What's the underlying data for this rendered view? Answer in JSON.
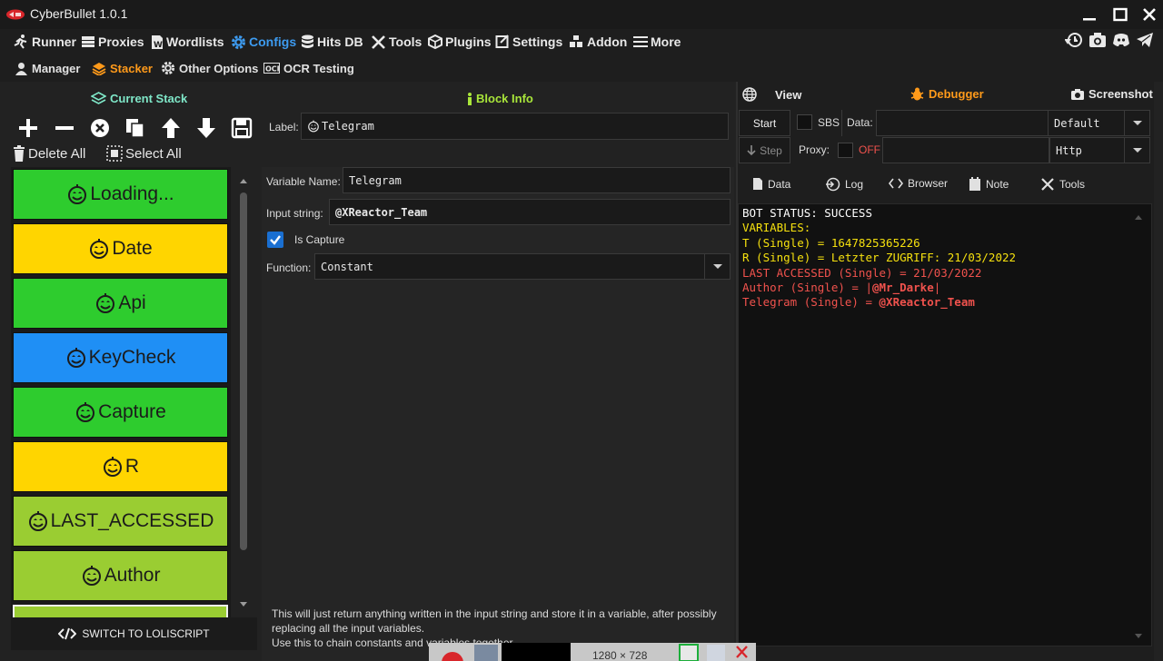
{
  "app": {
    "title": "CyberBullet 1.0.1"
  },
  "main_menu": [
    {
      "label": "Runner",
      "icon": "runner-icon"
    },
    {
      "label": "Proxies",
      "icon": "proxies-icon"
    },
    {
      "label": "Wordlists",
      "icon": "wordlists-icon"
    },
    {
      "label": "Configs",
      "icon": "gear-icon",
      "active": true
    },
    {
      "label": "Hits DB",
      "icon": "database-icon"
    },
    {
      "label": "Tools",
      "icon": "tools-icon"
    },
    {
      "label": "Plugins",
      "icon": "plugins-icon"
    },
    {
      "label": "Settings",
      "icon": "settings-icon"
    },
    {
      "label": "Addon",
      "icon": "addon-icon"
    },
    {
      "label": "More",
      "icon": "hamburger-icon"
    }
  ],
  "sub_menu": [
    {
      "label": "Manager",
      "icon": "user-icon"
    },
    {
      "label": "Stacker",
      "icon": "layers-icon",
      "active": true
    },
    {
      "label": "Other Options",
      "icon": "gear-icon"
    },
    {
      "label": "OCR Testing",
      "icon": "ocr-icon"
    }
  ],
  "left": {
    "title": "Current Stack",
    "delete_all": "Delete All",
    "select_all": "Select All",
    "switch_label": "SWITCH TO LOLISCRIPT"
  },
  "stack_blocks": [
    {
      "label": "Loading...",
      "color": "#2ecc2e"
    },
    {
      "label": "Date",
      "color": "#ffd500"
    },
    {
      "label": "Api",
      "color": "#2ecc2e"
    },
    {
      "label": "KeyCheck",
      "color": "#1f8ff5"
    },
    {
      "label": "Capture",
      "color": "#2ecc2e"
    },
    {
      "label": "R",
      "color": "#ffd500"
    },
    {
      "label": "LAST_ACCESSED",
      "color": "#9acd32"
    },
    {
      "label": "Author",
      "color": "#9acd32"
    }
  ],
  "block_info": {
    "title": "Block Info",
    "label_caption": "Label:",
    "label_value": "Telegram",
    "variable_name_caption": "Variable Name:",
    "variable_name_value": "Telegram",
    "input_string_caption": "Input string:",
    "input_string_value": "@XReactor_Team",
    "is_capture_label": "Is Capture",
    "function_caption": "Function:",
    "function_value": "Constant",
    "description_1": "This will just return anything written in the input string and store it in a variable, after possibly replacing all the input variables.",
    "description_2": "Use this to chain constants and variables together."
  },
  "debugger": {
    "view_label": "View",
    "debugger_label": "Debugger",
    "screenshot_label": "Screenshot",
    "start_label": "Start",
    "sbs_label": "SBS",
    "data_caption": "Data:",
    "data_select": "Default",
    "step_label": "Step",
    "proxy_caption": "Proxy:",
    "proxy_state": "OFF",
    "proxy_select": "Http",
    "tabs": [
      "Data",
      "Log",
      "Browser",
      "Note",
      "Tools"
    ]
  },
  "console": {
    "line1": "BOT STATUS: SUCCESS",
    "line2": "VARIABLES:",
    "line3": "T (Single) = 1647825365226",
    "line4": "R (Single) = Letzter ZUGRIFF: 21/03/2022",
    "line5": "LAST ACCESSED (Single) = 21/03/2022",
    "line6_prefix": "Author (Single) = |",
    "line6_value": "@Mr_Darke",
    "line6_suffix": "|",
    "line7_prefix": "Telegram (Single) = ",
    "line7_value": "@XReactor_Team"
  },
  "taskbar": {
    "size_text": "1280 × 728"
  },
  "colors": {
    "accent_blue": "#3d9bf0",
    "accent_orange": "#ff9a1a",
    "console_yellow": "#f5e00e",
    "console_red": "#f0524d"
  }
}
